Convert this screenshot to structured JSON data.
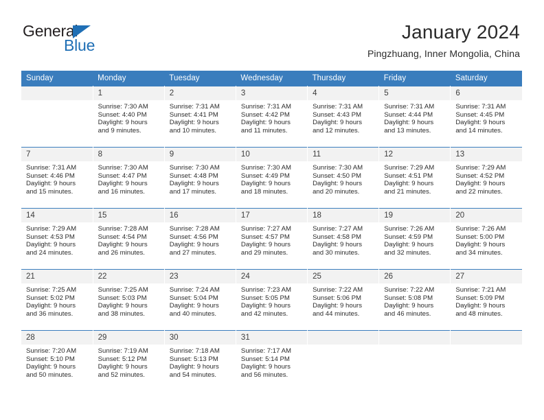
{
  "logo": {
    "word_general": "General",
    "word_blue": "Blue",
    "triangle_color": "#1f6fb5"
  },
  "header": {
    "title": "January 2024",
    "subtitle": "Pingzhuang, Inner Mongolia, China"
  },
  "theme": {
    "header_row_bg": "#3a7dbd",
    "daynum_bg": "#f2f2f2",
    "text_color": "#2b2b2b"
  },
  "weekdays": [
    "Sunday",
    "Monday",
    "Tuesday",
    "Wednesday",
    "Thursday",
    "Friday",
    "Saturday"
  ],
  "labels": {
    "sunrise_prefix": "Sunrise:",
    "sunset_prefix": "Sunset:",
    "daylight_prefix": "Daylight:"
  },
  "weeks": [
    [
      {
        "day": "",
        "empty": true
      },
      {
        "day": "1",
        "sunrise": "Sunrise: 7:30 AM",
        "sunset": "Sunset: 4:40 PM",
        "daylight_line1": "Daylight: 9 hours",
        "daylight_line2": "and 9 minutes."
      },
      {
        "day": "2",
        "sunrise": "Sunrise: 7:31 AM",
        "sunset": "Sunset: 4:41 PM",
        "daylight_line1": "Daylight: 9 hours",
        "daylight_line2": "and 10 minutes."
      },
      {
        "day": "3",
        "sunrise": "Sunrise: 7:31 AM",
        "sunset": "Sunset: 4:42 PM",
        "daylight_line1": "Daylight: 9 hours",
        "daylight_line2": "and 11 minutes."
      },
      {
        "day": "4",
        "sunrise": "Sunrise: 7:31 AM",
        "sunset": "Sunset: 4:43 PM",
        "daylight_line1": "Daylight: 9 hours",
        "daylight_line2": "and 12 minutes."
      },
      {
        "day": "5",
        "sunrise": "Sunrise: 7:31 AM",
        "sunset": "Sunset: 4:44 PM",
        "daylight_line1": "Daylight: 9 hours",
        "daylight_line2": "and 13 minutes."
      },
      {
        "day": "6",
        "sunrise": "Sunrise: 7:31 AM",
        "sunset": "Sunset: 4:45 PM",
        "daylight_line1": "Daylight: 9 hours",
        "daylight_line2": "and 14 minutes."
      }
    ],
    [
      {
        "day": "7",
        "sunrise": "Sunrise: 7:31 AM",
        "sunset": "Sunset: 4:46 PM",
        "daylight_line1": "Daylight: 9 hours",
        "daylight_line2": "and 15 minutes."
      },
      {
        "day": "8",
        "sunrise": "Sunrise: 7:30 AM",
        "sunset": "Sunset: 4:47 PM",
        "daylight_line1": "Daylight: 9 hours",
        "daylight_line2": "and 16 minutes."
      },
      {
        "day": "9",
        "sunrise": "Sunrise: 7:30 AM",
        "sunset": "Sunset: 4:48 PM",
        "daylight_line1": "Daylight: 9 hours",
        "daylight_line2": "and 17 minutes."
      },
      {
        "day": "10",
        "sunrise": "Sunrise: 7:30 AM",
        "sunset": "Sunset: 4:49 PM",
        "daylight_line1": "Daylight: 9 hours",
        "daylight_line2": "and 18 minutes."
      },
      {
        "day": "11",
        "sunrise": "Sunrise: 7:30 AM",
        "sunset": "Sunset: 4:50 PM",
        "daylight_line1": "Daylight: 9 hours",
        "daylight_line2": "and 20 minutes."
      },
      {
        "day": "12",
        "sunrise": "Sunrise: 7:29 AM",
        "sunset": "Sunset: 4:51 PM",
        "daylight_line1": "Daylight: 9 hours",
        "daylight_line2": "and 21 minutes."
      },
      {
        "day": "13",
        "sunrise": "Sunrise: 7:29 AM",
        "sunset": "Sunset: 4:52 PM",
        "daylight_line1": "Daylight: 9 hours",
        "daylight_line2": "and 22 minutes."
      }
    ],
    [
      {
        "day": "14",
        "sunrise": "Sunrise: 7:29 AM",
        "sunset": "Sunset: 4:53 PM",
        "daylight_line1": "Daylight: 9 hours",
        "daylight_line2": "and 24 minutes."
      },
      {
        "day": "15",
        "sunrise": "Sunrise: 7:28 AM",
        "sunset": "Sunset: 4:54 PM",
        "daylight_line1": "Daylight: 9 hours",
        "daylight_line2": "and 26 minutes."
      },
      {
        "day": "16",
        "sunrise": "Sunrise: 7:28 AM",
        "sunset": "Sunset: 4:56 PM",
        "daylight_line1": "Daylight: 9 hours",
        "daylight_line2": "and 27 minutes."
      },
      {
        "day": "17",
        "sunrise": "Sunrise: 7:27 AM",
        "sunset": "Sunset: 4:57 PM",
        "daylight_line1": "Daylight: 9 hours",
        "daylight_line2": "and 29 minutes."
      },
      {
        "day": "18",
        "sunrise": "Sunrise: 7:27 AM",
        "sunset": "Sunset: 4:58 PM",
        "daylight_line1": "Daylight: 9 hours",
        "daylight_line2": "and 30 minutes."
      },
      {
        "day": "19",
        "sunrise": "Sunrise: 7:26 AM",
        "sunset": "Sunset: 4:59 PM",
        "daylight_line1": "Daylight: 9 hours",
        "daylight_line2": "and 32 minutes."
      },
      {
        "day": "20",
        "sunrise": "Sunrise: 7:26 AM",
        "sunset": "Sunset: 5:00 PM",
        "daylight_line1": "Daylight: 9 hours",
        "daylight_line2": "and 34 minutes."
      }
    ],
    [
      {
        "day": "21",
        "sunrise": "Sunrise: 7:25 AM",
        "sunset": "Sunset: 5:02 PM",
        "daylight_line1": "Daylight: 9 hours",
        "daylight_line2": "and 36 minutes."
      },
      {
        "day": "22",
        "sunrise": "Sunrise: 7:25 AM",
        "sunset": "Sunset: 5:03 PM",
        "daylight_line1": "Daylight: 9 hours",
        "daylight_line2": "and 38 minutes."
      },
      {
        "day": "23",
        "sunrise": "Sunrise: 7:24 AM",
        "sunset": "Sunset: 5:04 PM",
        "daylight_line1": "Daylight: 9 hours",
        "daylight_line2": "and 40 minutes."
      },
      {
        "day": "24",
        "sunrise": "Sunrise: 7:23 AM",
        "sunset": "Sunset: 5:05 PM",
        "daylight_line1": "Daylight: 9 hours",
        "daylight_line2": "and 42 minutes."
      },
      {
        "day": "25",
        "sunrise": "Sunrise: 7:22 AM",
        "sunset": "Sunset: 5:06 PM",
        "daylight_line1": "Daylight: 9 hours",
        "daylight_line2": "and 44 minutes."
      },
      {
        "day": "26",
        "sunrise": "Sunrise: 7:22 AM",
        "sunset": "Sunset: 5:08 PM",
        "daylight_line1": "Daylight: 9 hours",
        "daylight_line2": "and 46 minutes."
      },
      {
        "day": "27",
        "sunrise": "Sunrise: 7:21 AM",
        "sunset": "Sunset: 5:09 PM",
        "daylight_line1": "Daylight: 9 hours",
        "daylight_line2": "and 48 minutes."
      }
    ],
    [
      {
        "day": "28",
        "sunrise": "Sunrise: 7:20 AM",
        "sunset": "Sunset: 5:10 PM",
        "daylight_line1": "Daylight: 9 hours",
        "daylight_line2": "and 50 minutes."
      },
      {
        "day": "29",
        "sunrise": "Sunrise: 7:19 AM",
        "sunset": "Sunset: 5:12 PM",
        "daylight_line1": "Daylight: 9 hours",
        "daylight_line2": "and 52 minutes."
      },
      {
        "day": "30",
        "sunrise": "Sunrise: 7:18 AM",
        "sunset": "Sunset: 5:13 PM",
        "daylight_line1": "Daylight: 9 hours",
        "daylight_line2": "and 54 minutes."
      },
      {
        "day": "31",
        "sunrise": "Sunrise: 7:17 AM",
        "sunset": "Sunset: 5:14 PM",
        "daylight_line1": "Daylight: 9 hours",
        "daylight_line2": "and 56 minutes."
      },
      {
        "day": "",
        "empty": true
      },
      {
        "day": "",
        "empty": true
      },
      {
        "day": "",
        "empty": true
      }
    ]
  ]
}
